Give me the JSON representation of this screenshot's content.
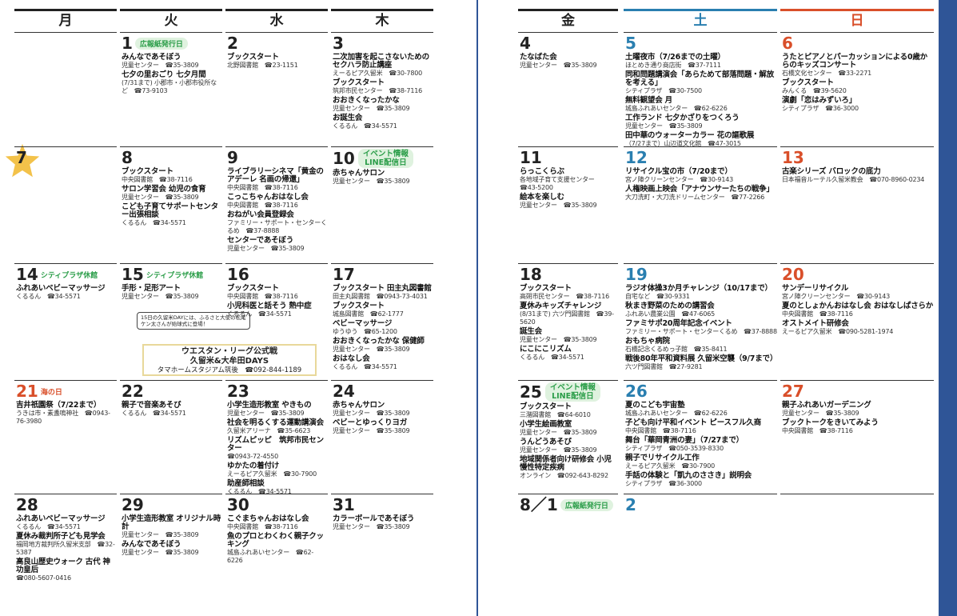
{
  "left_page": {
    "headers": [
      "月",
      "火",
      "水",
      "木"
    ],
    "rows": [
      [
        {
          "day": "",
          "tag": "",
          "events": []
        },
        {
          "day": "1",
          "tag": "広報紙発行日",
          "pill": true,
          "events": [
            {
              "t": "みんなであそぼう",
              "s": "児童センター　☎35-3809"
            },
            {
              "t": "七夕の里おごり 七夕月間",
              "s": "(7/31まで) 小郡市・小郡市役所など　☎73-9103"
            }
          ]
        },
        {
          "day": "2",
          "tag": "",
          "events": [
            {
              "t": "ブックスタート",
              "s": "北野図書館　☎23-1151"
            }
          ]
        },
        {
          "day": "3",
          "tag": "",
          "events": [
            {
              "t": "二次加害を起こさないためのセクハラ防止講座",
              "s": "えーるピア久留米　☎30-7800"
            },
            {
              "t": "ブックスタート",
              "s": "筑邦市民センター　☎38-7116"
            },
            {
              "t": "おおきくなったかな",
              "s": "児童センター　☎35-3809"
            },
            {
              "t": "お誕生会",
              "s": "くるるん　☎34-5571"
            }
          ]
        }
      ],
      [
        {
          "day": "7",
          "tag": "",
          "events": []
        },
        {
          "day": "8",
          "tag": "",
          "events": [
            {
              "t": "ブックスタート",
              "s": "中央図書館　☎38-7116"
            },
            {
              "t": "サロン学習会 幼児の食育",
              "s": "児童センター　☎35-3809"
            },
            {
              "t": "こども子育てサポートセンター出張相談",
              "s": "くるるん　☎34-5571"
            }
          ]
        },
        {
          "day": "9",
          "tag": "",
          "events": [
            {
              "t": "ライブラリーシネマ「黄金のアデーレ 名画の帰還」",
              "s": "中央図書館　☎38-7116"
            },
            {
              "t": "こっこちゃんおはなし会",
              "s": "中央図書館　☎38-7116"
            },
            {
              "t": "おねがい会員登録会",
              "s": "ファミリー・サポート・センターくるめ　☎37-8888"
            },
            {
              "t": "センターであそぼう",
              "s": "児童センター　☎35-3809"
            }
          ]
        },
        {
          "day": "10",
          "tag": "イベント情報\nLINE配信日",
          "pill2": true,
          "events": [
            {
              "t": "赤ちゃんサロン",
              "s": "児童センター　☎35-3809"
            }
          ]
        }
      ],
      [
        {
          "day": "14",
          "tag": "シティプラザ休館",
          "events": [
            {
              "t": "ふれあいベビーマッサージ",
              "s": "くるるん　☎34-5571"
            }
          ]
        },
        {
          "day": "15",
          "tag": "シティプラザ休館",
          "events": [
            {
              "t": "手形・足形アート",
              "s": "児童センター　☎35-3809"
            }
          ]
        },
        {
          "day": "16",
          "tag": "",
          "events": [
            {
              "t": "ブックスタート",
              "s": "中央図書館　☎38-7116"
            },
            {
              "t": "小児科医と話そう 熱中症",
              "s": "くるるん　☎34-5571"
            }
          ]
        },
        {
          "day": "17",
          "tag": "",
          "events": [
            {
              "t": "ブックスタート 田主丸図書館",
              "s": "田主丸図書館　☎0943-73-4031"
            },
            {
              "t": "ブックスタート",
              "s": "城島図書館　☎62-1777"
            },
            {
              "t": "ベビーマッサージ",
              "s": "ゆうゆう　☎65-1200"
            },
            {
              "t": "おおきくなったかな 保健師",
              "s": "児童センター　☎35-3809"
            },
            {
              "t": "おはなし会",
              "s": "くるるん　☎34-5571"
            }
          ]
        }
      ],
      [
        {
          "day": "21",
          "tag": "海の日",
          "red": true,
          "events": [
            {
              "t": "吉井祇園祭（7/22まで）",
              "s": "うきは市・素盞嗚神社　☎0943-76-3980"
            }
          ]
        },
        {
          "day": "22",
          "tag": "",
          "events": [
            {
              "t": "親子で音楽あそび",
              "s": "くるるん　☎34-5571"
            }
          ]
        },
        {
          "day": "23",
          "tag": "",
          "events": [
            {
              "t": "小学生造形教室 やきもの",
              "s": "児童センター　☎35-3809"
            },
            {
              "t": "社会を明るくする運動講演会",
              "s": "久留米アリーナ　☎35-6623"
            },
            {
              "t": "リズムピッピ　筑邦市民センター",
              "s": "☎0943-72-4550"
            },
            {
              "t": "ゆかたの着付け",
              "s": "えーるピア久留米　☎30-7900"
            },
            {
              "t": "助産師相談",
              "s": "くるるん　☎34-5571"
            }
          ]
        },
        {
          "day": "24",
          "tag": "",
          "events": [
            {
              "t": "赤ちゃんサロン",
              "s": "児童センター　☎35-3809"
            },
            {
              "t": "ベビーとゆっくりヨガ",
              "s": "児童センター　☎35-3809"
            }
          ]
        }
      ],
      [
        {
          "day": "28",
          "tag": "",
          "events": [
            {
              "t": "ふれあいベビーマッサージ",
              "s": "くるるん　☎34-5571"
            },
            {
              "t": "夏休み裁判所子ども見学会",
              "s": "福岡地方裁判所久留米支部　☎32-5387"
            },
            {
              "t": "高良山歴史ウォーク 古代 神功皇后",
              "s": "☎080-5607-0416"
            }
          ]
        },
        {
          "day": "29",
          "tag": "",
          "events": [
            {
              "t": "小学生造形教室 オリジナル時計",
              "s": "児童センター　☎35-3809"
            },
            {
              "t": "みんなであそぼう",
              "s": "児童センター　☎35-3809"
            }
          ]
        },
        {
          "day": "30",
          "tag": "",
          "events": [
            {
              "t": "こぐまちゃんおはなし会",
              "s": "中央図書館　☎38-7116"
            },
            {
              "t": "魚のプロとわくわく親子クッキング",
              "s": "城島ふれあいセンター　☎62-6226"
            }
          ]
        },
        {
          "day": "31",
          "tag": "",
          "events": [
            {
              "t": "カラーボールであそぼう",
              "s": "児童センター　☎35-3809"
            }
          ]
        }
      ]
    ],
    "callout": "15日の久留米DAYには、ふるさと大使の松尾ケン太さんが始球式に登場！",
    "banner": {
      "line1": "ウエスタン・リーグ公式戦",
      "line2": "久留米&大牟田DAYS",
      "line3": "タマホームスタジアム筑後　☎092-844-1189"
    }
  },
  "right_page": {
    "headers": [
      "金",
      "土",
      "日"
    ],
    "rows": [
      [
        {
          "day": "4",
          "tag": "",
          "events": [
            {
              "t": "たなばた会",
              "s": "児童センター　☎35-3809"
            }
          ]
        },
        {
          "day": "5",
          "tag": "",
          "events": [
            {
              "t": "土曜夜市（7/26までの土曜）",
              "s": "ほとめき通り商店街　☎37-7111"
            },
            {
              "t": "同和問題講演会「あらためて部落問題・解放を考える」",
              "s": "シティプラザ　☎30-7500"
            },
            {
              "t": "無料観望会 月",
              "s": "城島ふれあいセンター　☎62-6226"
            },
            {
              "t": "工作ランド 七夕かざりをつくろう",
              "s": "児童センター　☎35-3809"
            },
            {
              "t": "田中華のウォーターカラー 花の謳歌展",
              "s": "（7/27まで）山辺道文化館　☎47-3015"
            }
          ]
        },
        {
          "day": "6",
          "tag": "",
          "events": [
            {
              "t": "うたとピアノとパーカッションによる0歳からのキッズコンサート",
              "s": "石橋文化センター　☎33-2271"
            },
            {
              "t": "ブックスタート",
              "s": "みんくる　☎39-5620"
            },
            {
              "t": "演劇「恋はみずいろ」",
              "s": "シティプラザ　☎36-3000"
            }
          ]
        }
      ],
      [
        {
          "day": "11",
          "tag": "",
          "events": [
            {
              "t": "らっこくらぶ",
              "s": "各地域子育て支援センター　☎43-5200"
            },
            {
              "t": "絵本を楽しむ",
              "s": "児童センター　☎35-3809"
            }
          ]
        },
        {
          "day": "12",
          "tag": "",
          "events": [
            {
              "t": "リサイクル宝の市（7/20まで）",
              "s": "宮ノ陣クリーンセンター　☎30-9143"
            },
            {
              "t": "人権映画上映会「アナウンサーたちの戦争」",
              "s": "大刀洗町・大刀洗ドリームセンター　☎77-2266"
            }
          ]
        },
        {
          "day": "13",
          "tag": "",
          "events": [
            {
              "t": "古楽シリーズ バロックの底力",
              "s": "日本福音ルーテル久留米教会　☎070-8960-0234"
            }
          ]
        }
      ],
      [
        {
          "day": "18",
          "tag": "",
          "events": [
            {
              "t": "ブックスタート",
              "s": "高朔市民センター　☎38-7116"
            },
            {
              "t": "夏休みキッズチャレンジ",
              "s": "(8/31まで) 六ツ門図書館　☎39-5620"
            },
            {
              "t": "誕生会",
              "s": "児童センター　☎35-3809"
            },
            {
              "t": "にこにこリズム",
              "s": "くるるん　☎34-5571"
            }
          ]
        },
        {
          "day": "19",
          "tag": "",
          "events": [
            {
              "t": "ラジオ体操3か月チャレンジ（10/17まで）",
              "s": "自宅など　☎30-9331"
            },
            {
              "t": "秋まき野菜のための講習会",
              "s": "ふれあい農業公園　☎47-6065"
            },
            {
              "t": "ファミサポ20周年記念イベント",
              "s": "ファミリー・サポート・センターくるめ　☎37-8888"
            },
            {
              "t": "おもちゃ病院",
              "s": "石橋記念くるめっ子館　☎35-8411"
            },
            {
              "t": "戦後80年平和資料展 久留米空襲（9/7まで）",
              "s": "六ツ門図書館　☎27-9281"
            }
          ]
        },
        {
          "day": "20",
          "tag": "",
          "events": [
            {
              "t": "サンデーリサイクル",
              "s": "宮ノ陣クリーンセンター　☎30-9143"
            },
            {
              "t": "夏のとしょかんおはなし会 おはなしぱさらか",
              "s": "中央図書館　☎38-7116"
            },
            {
              "t": "オストメイト研修会",
              "s": "えーるピア久留米　☎090-5281-1974"
            }
          ]
        }
      ],
      [
        {
          "day": "25",
          "tag": "イベント情報\nLINE配信日",
          "pill2": true,
          "events": [
            {
              "t": "ブックスタート",
              "s": "三潴図書館　☎64-6010"
            },
            {
              "t": "小学生絵画教室",
              "s": "児童センター　☎35-3809"
            },
            {
              "t": "うんどうあそび",
              "s": "児童センター　☎35-3809"
            },
            {
              "t": "地域関係者向け研修会 小児慢性特定疾病",
              "s": "オンライン　☎092-643-8292"
            }
          ]
        },
        {
          "day": "26",
          "tag": "",
          "events": [
            {
              "t": "夏のこども宇宙塾",
              "s": "城島ふれあいセンター　☎62-6226"
            },
            {
              "t": "子ども向け平和イベント ピースフル久商",
              "s": "中央図書館　☎38-7116"
            },
            {
              "t": "舞台「華岡青洲の妻」（7/27まで）",
              "s": "シティプラザ　☎050-3539-8330"
            },
            {
              "t": "親子でリサイクル工作",
              "s": "えーるピア久留米　☎30-7900"
            },
            {
              "t": "手話の体験と「凱九のささき」説明会",
              "s": "シティプラザ　☎36-3000"
            }
          ]
        },
        {
          "day": "27",
          "tag": "",
          "events": [
            {
              "t": "親子ふれあいガーデニング",
              "s": "児童センター　☎35-3809"
            },
            {
              "t": "ブックトークをきいてみよう",
              "s": "中央図書館　☎38-7116"
            }
          ]
        }
      ],
      [
        {
          "day": "8／1",
          "tag": "広報紙発行日",
          "pill": true,
          "events": []
        },
        {
          "day": "2",
          "tag": "",
          "events": []
        },
        {
          "day": "",
          "tag": "",
          "events": []
        }
      ]
    ]
  }
}
